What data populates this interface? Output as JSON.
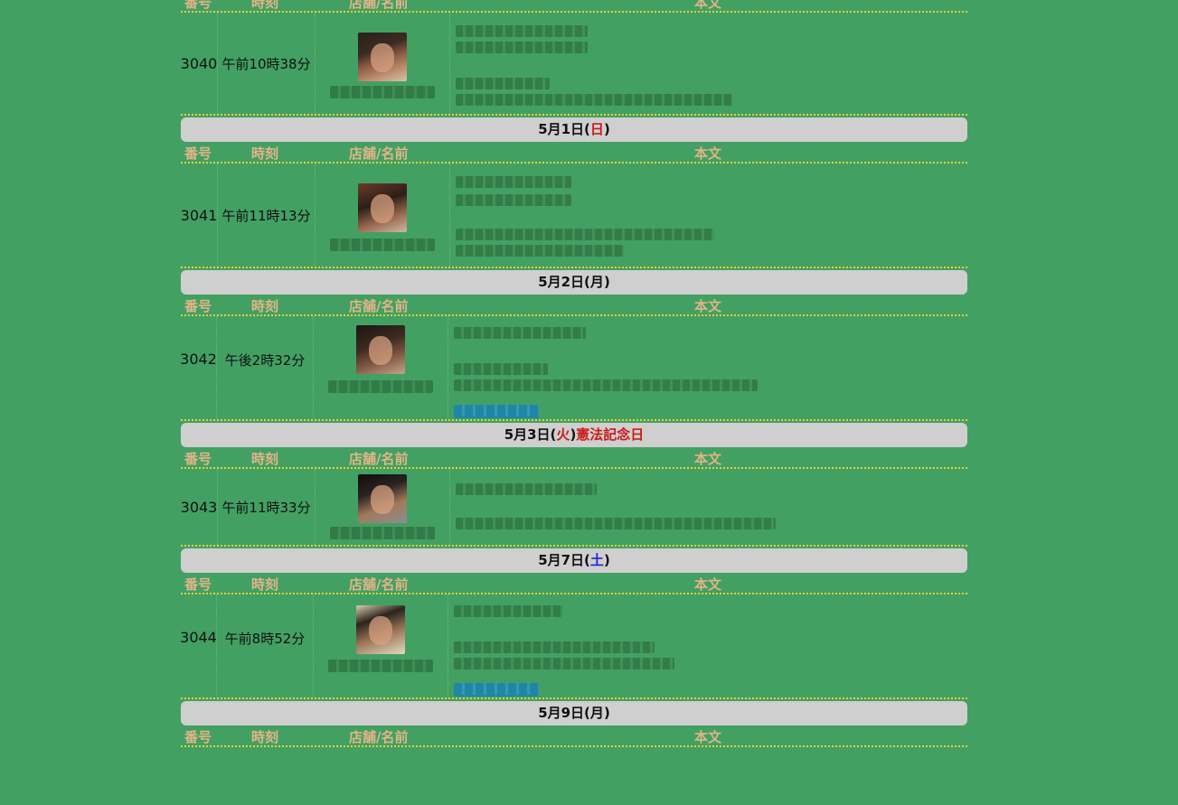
{
  "header": {
    "num": "番号",
    "time": "時刻",
    "shop": "店舗/名前",
    "body": "本文"
  },
  "posts": [
    {
      "num": "3040",
      "time": "午前10時38分"
    },
    {
      "num": "3041",
      "time": "午前11時13分"
    },
    {
      "num": "3042",
      "time": "午後2時32分"
    },
    {
      "num": "3043",
      "time": "午前11時33分"
    },
    {
      "num": "3044",
      "time": "午前8時52分"
    }
  ],
  "dates": [
    {
      "date": "5月1日(",
      "weekday": "日",
      "close": ")",
      "weekday_color": "#cc1a1a",
      "holiday": ""
    },
    {
      "date": "5月2日(",
      "weekday": "月",
      "close": ")",
      "weekday_color": "#111111",
      "holiday": ""
    },
    {
      "date": "5月3日(",
      "weekday": "火",
      "close": ")",
      "weekday_color": "#cc1a1a",
      "holiday": "憲法記念日"
    },
    {
      "date": "5月7日(",
      "weekday": "土",
      "close": ")",
      "weekday_color": "#1a2ad4",
      "holiday": ""
    },
    {
      "date": "5月9日(",
      "weekday": "月",
      "close": ")",
      "weekday_color": "#111111",
      "holiday": ""
    }
  ],
  "colors": {
    "background": "#43a063",
    "header_text": "#e2b488",
    "divider": "#e3d23c",
    "date_bar": "#cfcfcf",
    "sunday": "#cc1a1a",
    "saturday": "#1a2ad4"
  }
}
